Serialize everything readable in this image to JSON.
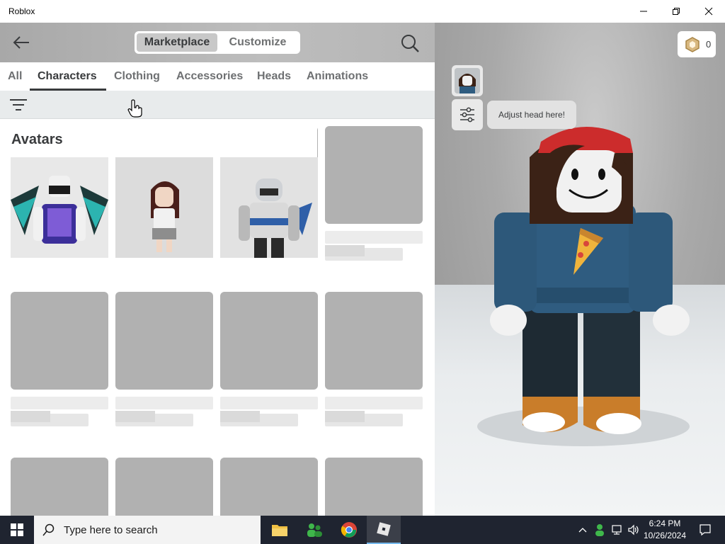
{
  "window": {
    "title": "Roblox"
  },
  "header": {
    "segments": {
      "marketplace": "Marketplace",
      "customize": "Customize"
    },
    "robux_count": "0"
  },
  "tabs": [
    "All",
    "Characters",
    "Clothing",
    "Accessories",
    "Heads",
    "Animations"
  ],
  "active_tab": "Characters",
  "avatars_section": {
    "title": "Avatars"
  },
  "viewport": {
    "tooltip": "Adjust head here!"
  },
  "taskbar": {
    "search_placeholder": "Type here to search",
    "time": "6:24 PM",
    "date": "10/26/2024"
  },
  "colors": {
    "accent_text": "#393b3d",
    "placeholder_gray": "#b1b1b1",
    "taskbar_bg": "#1f2430"
  }
}
